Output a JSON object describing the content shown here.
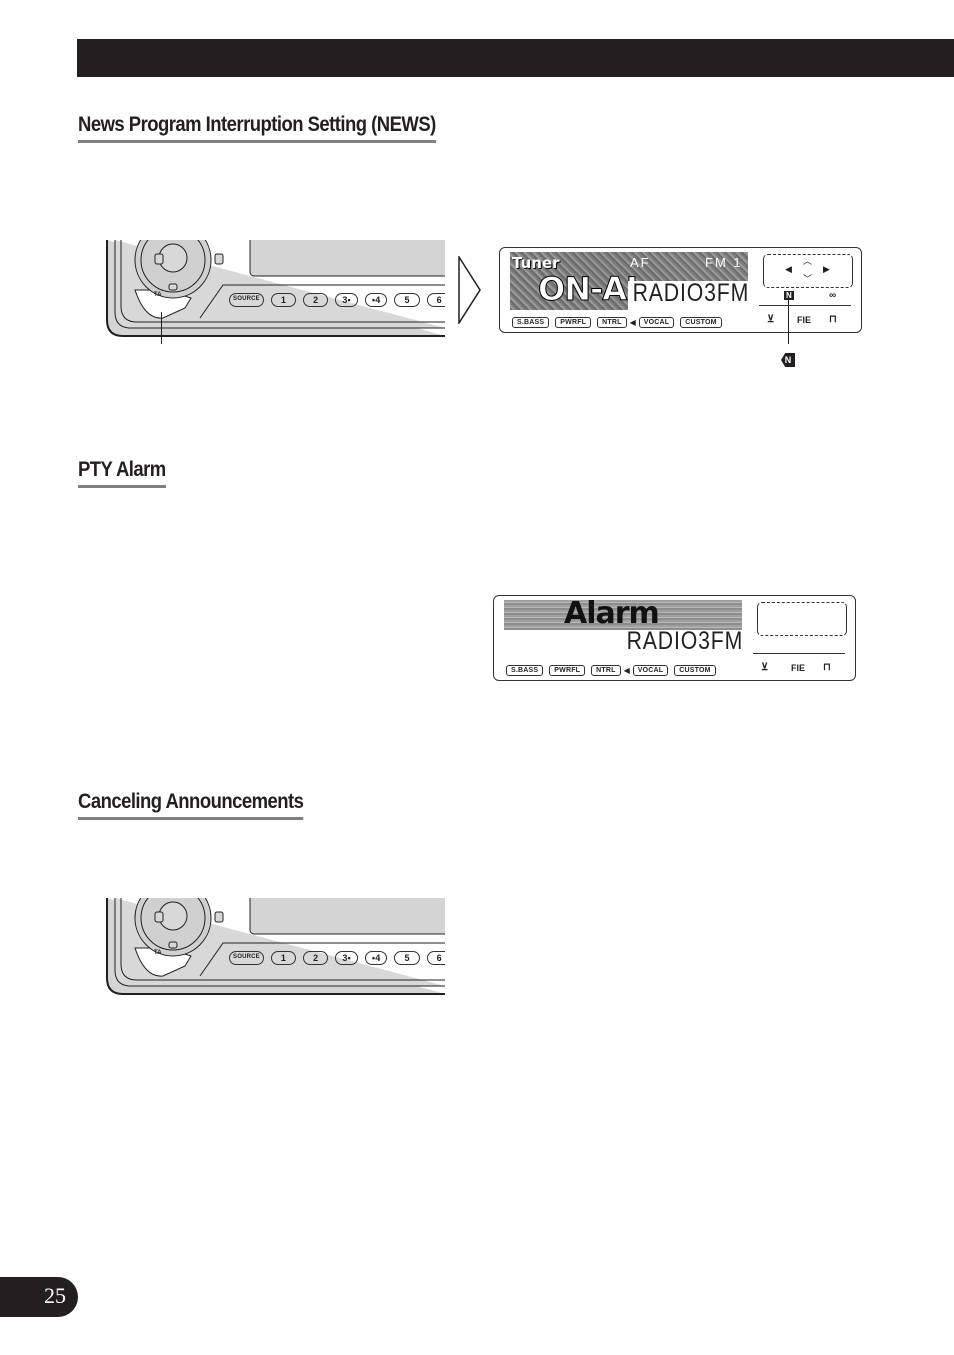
{
  "header_bar": {
    "color": "#231f20"
  },
  "sections": [
    {
      "heading": "News Program Interruption Setting (NEWS)"
    },
    {
      "heading": "PTY Alarm"
    },
    {
      "heading": "Canceling Announcements"
    }
  ],
  "head_unit": {
    "ta_label": "TA",
    "buttons": [
      "SOURCE",
      "1",
      "2",
      "3•",
      "•4",
      "5",
      "6"
    ]
  },
  "display_news": {
    "title": "Tuner",
    "af": "AF",
    "band": "FM 1",
    "image_text": "ON-AI",
    "frequency": "RADIO3FM",
    "eq_buttons": [
      "S.BASS",
      "PWRFL",
      "NTRL",
      "VOCAL",
      "CUSTOM"
    ],
    "fie_label": "FIE",
    "news_indicator": "N"
  },
  "display_alarm": {
    "title": "Alarm",
    "frequency": "RADIO3FM",
    "eq_buttons": [
      "S.BASS",
      "PWRFL",
      "NTRL",
      "VOCAL",
      "CUSTOM"
    ],
    "fie_label": "FIE"
  },
  "callout": {
    "news_icon": "N"
  },
  "page_number": "25"
}
